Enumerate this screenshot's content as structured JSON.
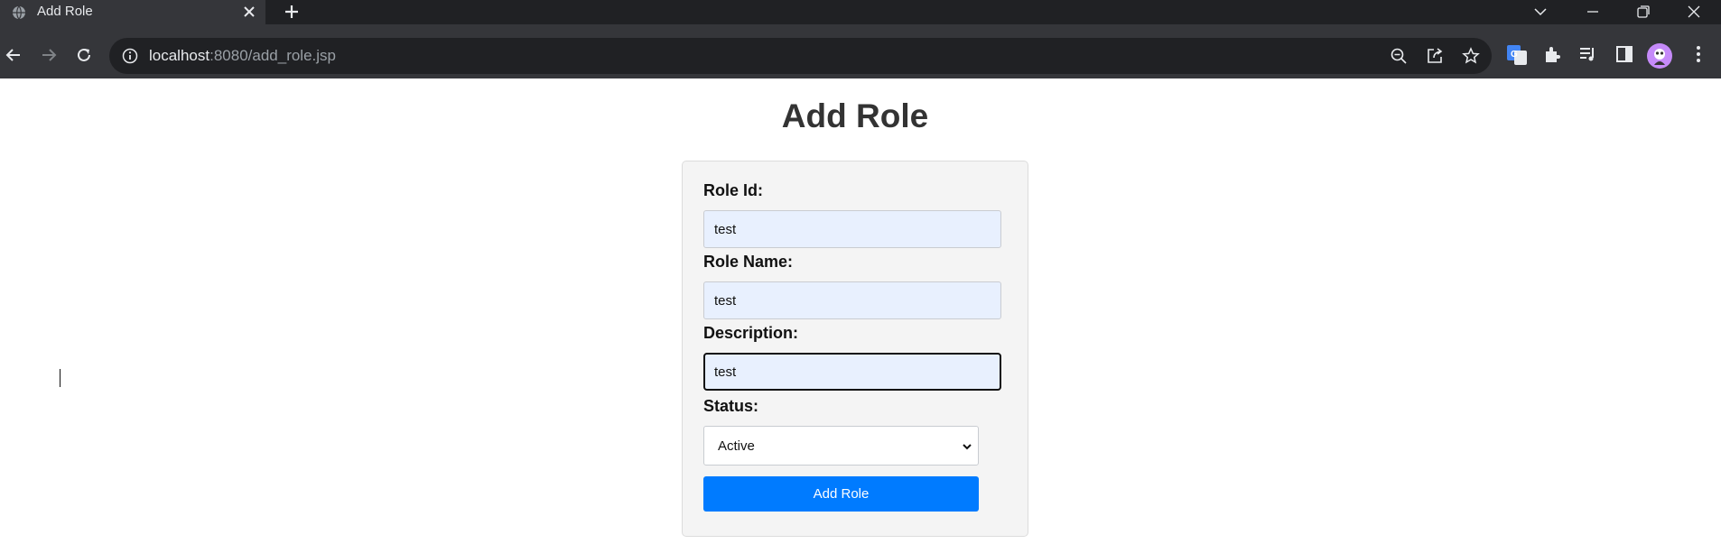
{
  "browser": {
    "tab_title": "Add Role",
    "url_host": "localhost",
    "url_rest": ":8080/add_role.jsp"
  },
  "page": {
    "title": "Add Role"
  },
  "form": {
    "role_id": {
      "label": "Role Id:",
      "value": "test"
    },
    "role_name": {
      "label": "Role Name:",
      "value": "test"
    },
    "description": {
      "label": "Description:",
      "value": "test"
    },
    "status": {
      "label": "Status:",
      "selected": "Active"
    },
    "submit_label": "Add Role"
  },
  "colors": {
    "accent": "#007bff",
    "input_autofill_bg": "#e8f0fe",
    "card_bg": "#f4f4f4",
    "title_text": "#333333",
    "chrome_dark": "#202124",
    "chrome_toolbar": "#35363a"
  },
  "icons": {
    "tab": "globe-icon",
    "tab_close": "close-icon",
    "new_tab": "plus-icon",
    "nav": [
      "back-arrow-icon",
      "forward-arrow-icon",
      "reload-icon"
    ],
    "omnibox": [
      "info-icon",
      "zoom-out-icon",
      "share-icon",
      "star-icon"
    ],
    "toolbar": [
      "google-translate-icon",
      "puzzle-extension-icon",
      "media-queue-icon",
      "side-panel-icon",
      "avatar",
      "kebab-menu-icon"
    ],
    "window": [
      "chevron-down-icon",
      "minimize-icon",
      "restore-icon",
      "close-window-icon"
    ],
    "select": "chevron-down-icon"
  }
}
